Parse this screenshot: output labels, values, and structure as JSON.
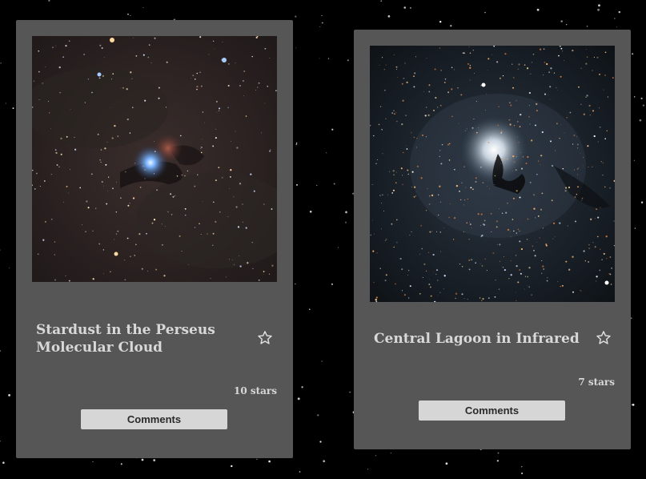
{
  "cards": [
    {
      "title": "Stardust in the Perseus Molecular Cloud",
      "stars_label": "10 stars",
      "comments_label": "Comments",
      "star_icon": "star-outline-icon"
    },
    {
      "title": "Central Lagoon in Infrared",
      "stars_label": "7 stars",
      "comments_label": "Comments",
      "star_icon": "star-outline-icon"
    }
  ],
  "colors": {
    "page_background": "#000000",
    "card_background": "#565656",
    "text": "#d8d8d8",
    "button_background": "#d6d6d6",
    "button_text": "#2a2a2a"
  }
}
